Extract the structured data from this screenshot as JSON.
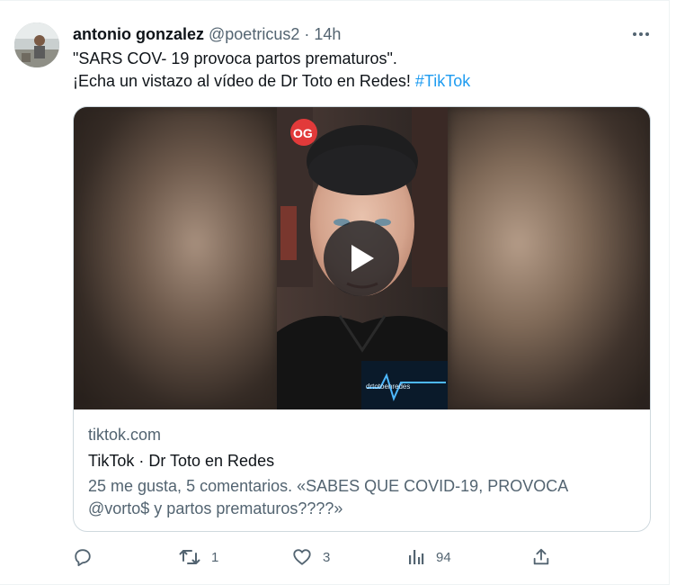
{
  "tweet": {
    "display_name": "antonio gonzalez",
    "handle": "@poetricus2",
    "separator": " · ",
    "time": "14h",
    "text_line1": "\"SARS COV- 19 provoca partos prematuros\".",
    "text_line2": "¡Echa un vistazo al vídeo de Dr Toto en Redes! ",
    "hashtag": "#TikTok"
  },
  "card": {
    "domain": "tiktok.com",
    "title": "TikTok · Dr Toto en Redes",
    "description": "25 me gusta, 5 comentarios. «SABES QUE COVID-19, PROVOCA @vorto$ y partos prematuros????»",
    "watermark": "drtotoenredes"
  },
  "actions": {
    "reply_count": "",
    "retweet_count": "1",
    "like_count": "3",
    "views_count": "94"
  },
  "icons": {
    "more": "more-icon",
    "play": "play-icon",
    "reply": "reply-icon",
    "retweet": "retweet-icon",
    "like": "like-icon",
    "views": "views-icon",
    "share": "share-icon"
  },
  "colors": {
    "accent": "#1d9bf0",
    "text": "#0f1419",
    "muted": "#536471",
    "border": "#cfd9de"
  }
}
